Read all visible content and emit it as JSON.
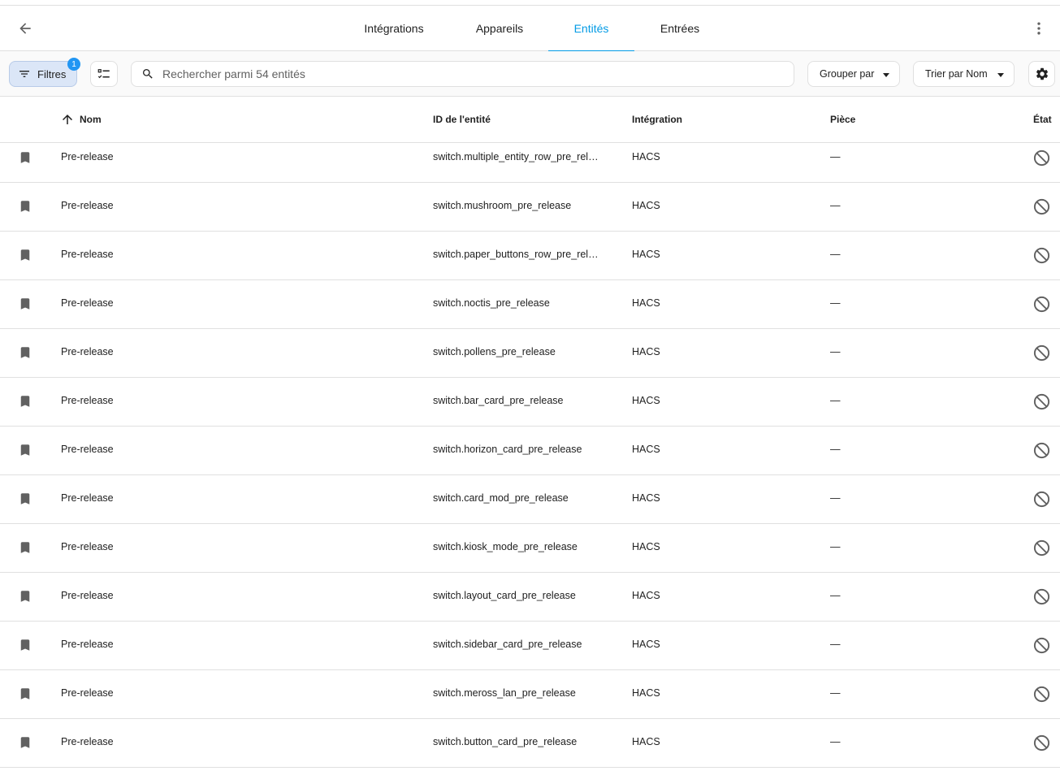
{
  "header": {
    "tabs": [
      {
        "label": "Intégrations",
        "active": false
      },
      {
        "label": "Appareils",
        "active": false
      },
      {
        "label": "Entités",
        "active": true
      },
      {
        "label": "Entrées",
        "active": false
      }
    ],
    "back_icon": "arrow-left-icon",
    "menu_icon": "dots-vertical-icon"
  },
  "toolbar": {
    "filters_label": "Filtres",
    "filters_badge": "1",
    "search_placeholder": "Rechercher parmi 54 entités",
    "group_by_label": "Grouper par",
    "sort_label": "Trier par Nom"
  },
  "table": {
    "columns": {
      "name": "Nom",
      "entity_id": "ID de l'entité",
      "integration": "Intégration",
      "area": "Pièce",
      "status": "État"
    },
    "sort": {
      "column": "name",
      "direction": "ascending"
    },
    "rows": [
      {
        "name": "Pre-release",
        "entity_id": "switch.multiple_entity_row_pre_rele…",
        "integration": "HACS",
        "area": "—",
        "icon": "bookmark-icon",
        "status_icon": "cancel-icon"
      },
      {
        "name": "Pre-release",
        "entity_id": "switch.mushroom_pre_release",
        "integration": "HACS",
        "area": "—",
        "icon": "bookmark-icon",
        "status_icon": "cancel-icon"
      },
      {
        "name": "Pre-release",
        "entity_id": "switch.paper_buttons_row_pre_rele…",
        "integration": "HACS",
        "area": "—",
        "icon": "bookmark-icon",
        "status_icon": "cancel-icon"
      },
      {
        "name": "Pre-release",
        "entity_id": "switch.noctis_pre_release",
        "integration": "HACS",
        "area": "—",
        "icon": "bookmark-icon",
        "status_icon": "cancel-icon"
      },
      {
        "name": "Pre-release",
        "entity_id": "switch.pollens_pre_release",
        "integration": "HACS",
        "area": "—",
        "icon": "bookmark-icon",
        "status_icon": "cancel-icon"
      },
      {
        "name": "Pre-release",
        "entity_id": "switch.bar_card_pre_release",
        "integration": "HACS",
        "area": "—",
        "icon": "bookmark-icon",
        "status_icon": "cancel-icon"
      },
      {
        "name": "Pre-release",
        "entity_id": "switch.horizon_card_pre_release",
        "integration": "HACS",
        "area": "—",
        "icon": "bookmark-icon",
        "status_icon": "cancel-icon"
      },
      {
        "name": "Pre-release",
        "entity_id": "switch.card_mod_pre_release",
        "integration": "HACS",
        "area": "—",
        "icon": "bookmark-icon",
        "status_icon": "cancel-icon"
      },
      {
        "name": "Pre-release",
        "entity_id": "switch.kiosk_mode_pre_release",
        "integration": "HACS",
        "area": "—",
        "icon": "bookmark-icon",
        "status_icon": "cancel-icon"
      },
      {
        "name": "Pre-release",
        "entity_id": "switch.layout_card_pre_release",
        "integration": "HACS",
        "area": "—",
        "icon": "bookmark-icon",
        "status_icon": "cancel-icon"
      },
      {
        "name": "Pre-release",
        "entity_id": "switch.sidebar_card_pre_release",
        "integration": "HACS",
        "area": "—",
        "icon": "bookmark-icon",
        "status_icon": "cancel-icon"
      },
      {
        "name": "Pre-release",
        "entity_id": "switch.meross_lan_pre_release",
        "integration": "HACS",
        "area": "—",
        "icon": "bookmark-icon",
        "status_icon": "cancel-icon"
      },
      {
        "name": "Pre-release",
        "entity_id": "switch.button_card_pre_release",
        "integration": "HACS",
        "area": "—",
        "icon": "bookmark-icon",
        "status_icon": "cancel-icon"
      }
    ]
  },
  "colors": {
    "accent": "#039be5",
    "badge": "#2196f3",
    "filter_bg": "#dbe6f7",
    "icon": "#616161",
    "divider": "#e0e0e0"
  }
}
